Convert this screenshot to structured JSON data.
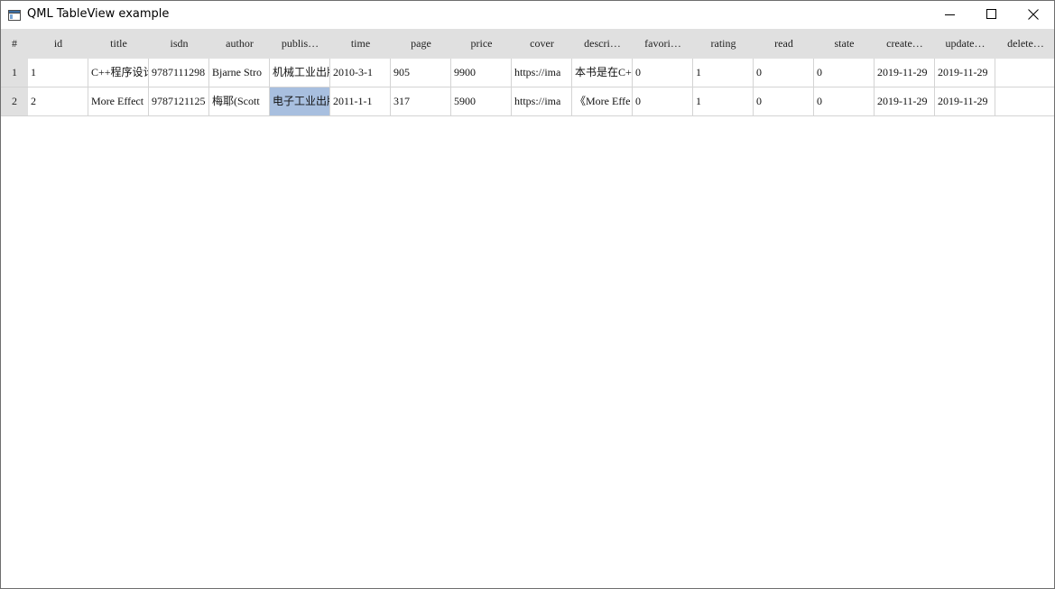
{
  "window": {
    "title": "QML TableView example",
    "icons": {
      "app": "app-window-icon",
      "minimize": "minimize-icon",
      "maximize": "maximize-icon",
      "close": "close-icon"
    }
  },
  "table": {
    "corner_label": "#",
    "columns": [
      "id",
      "title",
      "isdn",
      "author",
      "publis…",
      "time",
      "page",
      "price",
      "cover",
      "descri…",
      "favori…",
      "rating",
      "read",
      "state",
      "create…",
      "update…",
      "delete…"
    ],
    "rows": [
      {
        "num": "1",
        "cells": [
          "1",
          "C++程序设计",
          "9787111298",
          "Bjarne Stro",
          "机械工业出版",
          "2010-3-1",
          "905",
          "9900",
          "https://ima",
          "本书是在C++",
          "0",
          "1",
          "0",
          "0",
          "2019-11-29",
          "2019-11-29",
          ""
        ]
      },
      {
        "num": "2",
        "cells": [
          "2",
          "More Effect",
          "9787121125",
          "梅耶(Scott",
          "电子工业出版",
          "2011-1-1",
          "317",
          "5900",
          "https://ima",
          "《More Effe",
          "0",
          "1",
          "0",
          "0",
          "2019-11-29",
          "2019-11-29",
          ""
        ]
      }
    ],
    "selected_cell": {
      "row": 2,
      "column": "publis…"
    },
    "colors": {
      "header_bg": "#e0e0e0",
      "selection_bg": "#a8bfdf",
      "grid_line": "#d4d4d4"
    }
  }
}
